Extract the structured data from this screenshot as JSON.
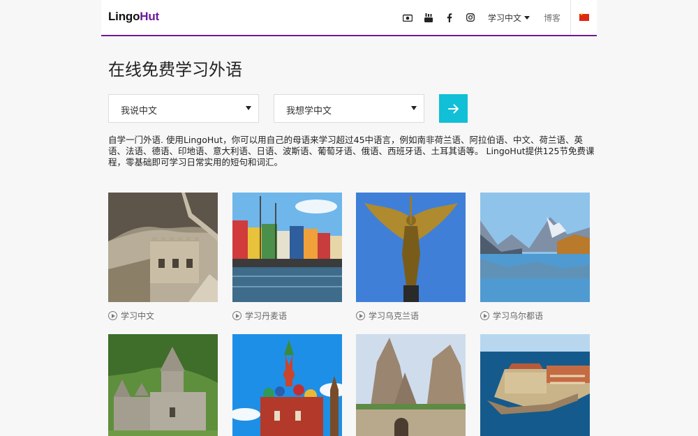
{
  "header": {
    "logo_part1": "Lingo",
    "logo_part2": "Hut",
    "icons": [
      "camera-icon",
      "youtube-icon",
      "facebook-icon",
      "instagram-icon"
    ],
    "lang_menu_label": "学习中文",
    "blog_label": "博客",
    "flag": "china-flag-icon",
    "accent_color": "#6a1b9a"
  },
  "main": {
    "title": "在线免费学习外语",
    "speak_select": "我说中文",
    "learn_select": "我想学中文",
    "go_button_color": "#11bfd6",
    "description": "自学一门外语. 使用LingoHut，你可以用自己的母语来学习超过45中语言，例如南非荷兰语、阿拉伯语、中文、荷兰语、英语、法语、德语、印地语、意大利语、日语、波斯语、葡萄牙语、俄语、西班牙语、土耳其语等。 LingoHut提供125节免费课程，零基础即可学习日常实用的短句和词汇。"
  },
  "languages": [
    {
      "label": "学习中文",
      "image": "great-wall"
    },
    {
      "label": "学习丹麦语",
      "image": "copenhagen-harbor"
    },
    {
      "label": "学习乌克兰语",
      "image": "golden-angel-statue"
    },
    {
      "label": "学习乌尔都语",
      "image": "mountain-lake"
    },
    {
      "label": "",
      "image": "armenian-monastery"
    },
    {
      "label": "",
      "image": "st-basils-cathedral"
    },
    {
      "label": "",
      "image": "rock-fortress"
    },
    {
      "label": "",
      "image": "coastal-old-town"
    }
  ]
}
